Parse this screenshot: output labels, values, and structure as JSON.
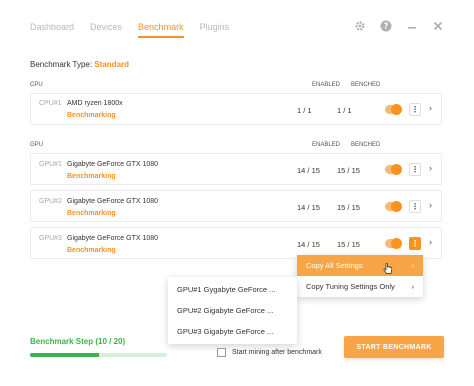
{
  "nav": {
    "tabs": [
      {
        "label": "Dashboard",
        "active": false
      },
      {
        "label": "Devices",
        "active": false
      },
      {
        "label": "Benchmark",
        "active": true
      },
      {
        "label": "Plugins",
        "active": false
      }
    ],
    "icons": [
      "gear-icon",
      "help-icon",
      "minimize-icon",
      "close-icon"
    ]
  },
  "benchmark_type": {
    "label": "Benchmark Type:",
    "value": "Standard"
  },
  "cpu_section": {
    "header": {
      "name": "CPU",
      "enabled": "ENABLED",
      "benched": "BENCHED"
    },
    "rows": [
      {
        "id": "CPU#1",
        "name": "AMD ryzen 1800x",
        "status": "Benchmarking",
        "enabled": "1 / 1",
        "benched": "1 / 1"
      }
    ]
  },
  "gpu_section": {
    "header": {
      "name": "GPU",
      "enabled": "ENABLED",
      "benched": "BENCHED"
    },
    "rows": [
      {
        "id": "GPU#1",
        "name": "Gigabyte GeForce GTX 1080",
        "status": "Benchmarking",
        "enabled": "14 / 15",
        "benched": "15 / 15"
      },
      {
        "id": "GPU#2",
        "name": "Gigabyte GeForce GTX 1080",
        "status": "Benchmarking",
        "enabled": "14 / 15",
        "benched": "15 / 15"
      },
      {
        "id": "GPU#3",
        "name": "Gigabyte GeForce GTX 1080",
        "status": "Benchmarking",
        "enabled": "14 / 15",
        "benched": "15 / 15"
      }
    ]
  },
  "context_menu": {
    "items": [
      {
        "label": "Copy All Settings",
        "highlighted": true
      },
      {
        "label": "Copy Tuning Settings Only",
        "highlighted": false
      }
    ]
  },
  "submenu": {
    "items": [
      "GPU#1 Gygabyte GeForce ...",
      "GPU#2 Gigabyte GeForce ...",
      "GPU#3 Gigabyte GeForce ..."
    ]
  },
  "footer": {
    "step_label": "Benchmark Step (10 / 20)",
    "progress": 0.5,
    "mining_label": "Start mining after benchmark",
    "start_button": "START BENCHMARK"
  },
  "colors": {
    "accent": "#f7931e",
    "success": "#3cb44b"
  }
}
